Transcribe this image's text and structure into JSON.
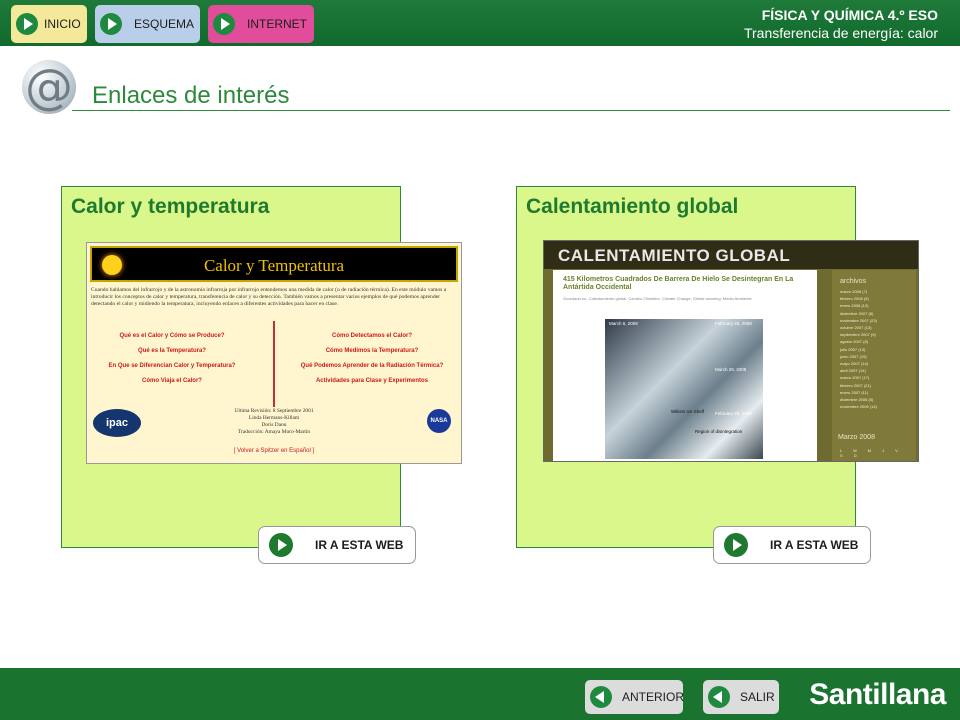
{
  "nav": {
    "inicio": "INICIO",
    "esquema": "ESQUEMA",
    "internet": "INTERNET"
  },
  "header": {
    "course": "FÍSICA Y QUÍMICA 4.º ESO",
    "topic": "Transferencia de energía: calor"
  },
  "page": {
    "title": "Enlaces de interés"
  },
  "cards": [
    {
      "title": "Calor y temperatura",
      "button": "IR A ESTA WEB",
      "preview": {
        "site_title": "Calor y Temperatura",
        "intro": "Cuando hablamos del infrarrojo y de la astronomía infrarroja por infrarrojo entendemos una medida de calor (o de radiación térmica). En este módulo vamos a introducir los conceptos de calor y temperatura, transferencia de calor y su detección. También vamos a presentar varios ejemplos de qué podemos aprender detectando el calor y midiendo la temperatura, incluyendo enlaces a diferentes actividades para hacer en clase.",
        "links_left": [
          "Qué es el Calor y Cómo se Produce?",
          "Qué es la Temperatura?",
          "En Que se Diferencian Calor y Temperatura?",
          "Cómo Viaja el Calor?"
        ],
        "links_right": [
          "Cómo Detectamos el Calor?",
          "Cómo Medimos la Temperatura?",
          "Qué Podemos Aprender de la Radiación Térmica?",
          "Actividades para Clase y Experimentos"
        ],
        "logo_left": "ipac",
        "logo_right": "NASA",
        "credits": [
          "Ultima Revisión: 8 Septiembre 2001",
          "Linda Hermans-Killam",
          "Doris Daou",
          "Traducción: Amaya Moro-Martín"
        ],
        "back_link": "[ Volver a Spitzer en Español ]"
      }
    },
    {
      "title": "Calentamiento global",
      "button": "IR A ESTA WEB",
      "preview": {
        "site_title": "CALENTAMIENTO GLOBAL",
        "post_title": "415 Kilometros Cuadrados De Barrera De Hielo Se Desintegran En La Antártida Occidental",
        "post_meta": "Guardado en: Calentamiento global, Cambio Climático, Climate Change, Global warming, Medio Ambiente",
        "image_labels": [
          "March 6, 2008",
          "February 28, 2008",
          "March 29, 2008",
          "Wilkins Ice Shelf",
          "Region of disintegration",
          "February 29, 2008"
        ],
        "archive_title": "archivos",
        "archive_items": [
          "marzo 2008 (7)",
          "febrero 2008 (9)",
          "enero 2008 (10)",
          "diciembre 2007 (8)",
          "noviembre 2007 (23)",
          "octubre 2007 (13)",
          "septiembre 2007 (9)",
          "agosto 2007 (8)",
          "julio 2007 (13)",
          "junio 2007 (19)",
          "mayo 2007 (14)",
          "abril 2007 (14)",
          "marzo 2007 (17)",
          "febrero 2007 (21)",
          "enero 2007 (11)",
          "diciembre 2006 (5)",
          "noviembre 2006 (14)"
        ],
        "calendar_title": "Marzo 2008",
        "calendar_days": "L M M J V S D"
      }
    }
  ],
  "footer": {
    "anterior": "ANTERIOR",
    "salir": "SALIR",
    "brand": "Santillana"
  }
}
